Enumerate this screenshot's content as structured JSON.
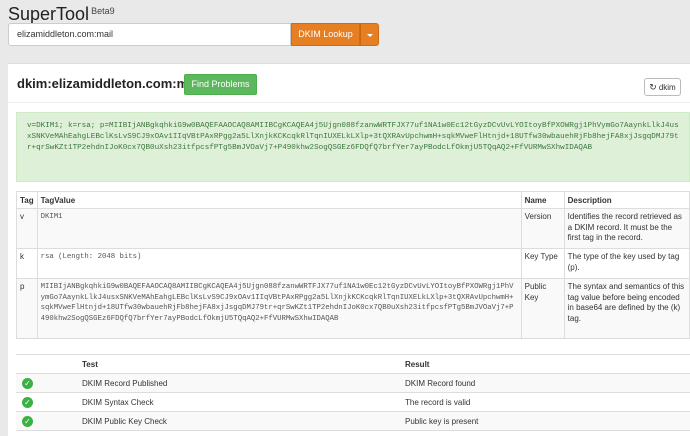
{
  "app": {
    "name": "SuperTool",
    "badge": "Beta9"
  },
  "search": {
    "value": "elizamiddleton.com:mail",
    "button_label": "DKIM Lookup"
  },
  "result": {
    "title": "dkim:elizamiddleton.com:mail",
    "find_problems_label": "Find Problems",
    "refresh_label": "dkim",
    "raw_record": "v=DKIM1; k=rsa; p=MIIBIjANBgkqhkiG9w0BAQEFAAOCAQ8AMIIBCgKCAQEA4j5Ujgn088fzanwWRTFJX77uf1NA1w0Ec12tGyzDCvUvLYOItoyBfPXOWRgj1PhVymGo7AaynkLlkJ4usxSNKVeMAhEahgLEBclKsLvS9CJ9xOAv1IIqVBtPAxRPgg2a5LlXnjkKCKcqkRlTqnIUXELkLXlp+3tQXRAvUpchwmH+sqkMVweFlHtnjd+18UTfw30wbauehRjFb8hejFA8xjJsgqDMJ79tr+qrSwKZt1TP2ehdnIJoK0cx7QB0uXsh23itfpcsfPTg5BmJVOaVj7+P490khw2SogQSGEz6FDQfQ7brfYer7ayPBodcLfOkmjU5TQqAQ2+FfVURMwSXhwIDAQAB"
  },
  "tag_table": {
    "headers": [
      "Tag",
      "TagValue",
      "Name",
      "Description"
    ],
    "rows": [
      {
        "tag": "v",
        "value": "DKIM1",
        "name": "Version",
        "description": "Identifies the record retrieved as a DKIM record. It must be the first tag in the record."
      },
      {
        "tag": "k",
        "value": "rsa (Length: 2048 bits)",
        "name": "Key Type",
        "description": "The type of the key used by tag (p)."
      },
      {
        "tag": "p",
        "value": "MIIBIjANBgkqhkiG9w0BAQEFAAOCAQ8AMIIBCgKCAQEA4j5Ujgn088fzanwWRTFJX77uf1NA1w0Ec12tGyzDCvUvLYOItoyBfPXOWRgj1PhVymGo7AaynkLlkJ4usxSNKVeMAhEahgLEBclKsLvS9CJ9xOAv1IIqVBtPAxRPgg2a5LlXnjkKCKcqkRlTqnIUXELkLXlp+3tQXRAvUpchwmH+sqkMVweFlHtnjd+18UTfw30wbauehRjFb8hejFA8xjJsgqDMJ79tr+qrSwKZt1TP2ehdnIJoK0cx7QB0uXsh23itfpcsfPTg5BmJVOaVj7+P490khw2SogQSGEz6FDQfQ7brfYer7ayPBodcLfOkmjU5TQqAQ2+FfVURMwSXhwIDAQAB",
        "name": "Public Key",
        "description": "The syntax and semantics of this tag value before being encoded in base64 are defined by the (k) tag."
      }
    ]
  },
  "results_table": {
    "headers": [
      "",
      "Test",
      "Result"
    ],
    "rows": [
      {
        "status": "ok",
        "test": "DKIM Record Published",
        "result": "DKIM Record found"
      },
      {
        "status": "ok",
        "test": "DKIM Syntax Check",
        "result": "The record is valid"
      },
      {
        "status": "ok",
        "test": "DKIM Public Key Check",
        "result": "Public key is present"
      }
    ]
  },
  "colors": {
    "accent_orange": "#e67e22",
    "success_green": "#5cb85c",
    "record_bg": "#dff0d8",
    "record_text": "#3c763d"
  }
}
